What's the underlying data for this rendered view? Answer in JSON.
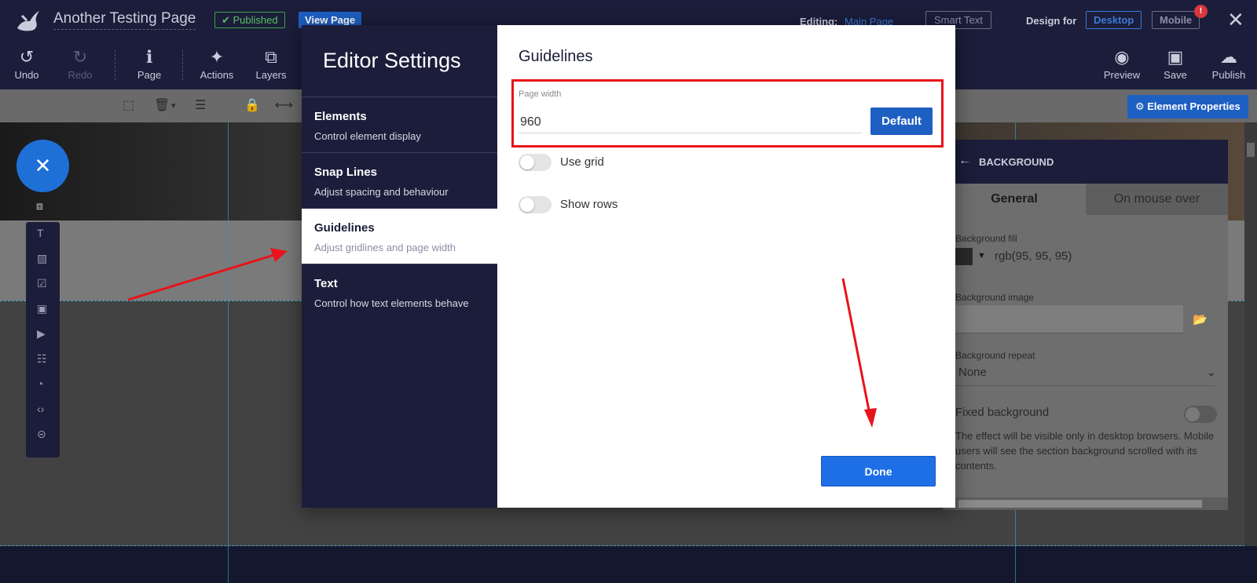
{
  "header": {
    "page_title": "Another Testing Page",
    "published_badge": "✔ Published",
    "view_page": "View Page",
    "editing_label": "Editing:",
    "editing_value": "Main Page",
    "smart_text": "Smart Text",
    "design_for": "Design for",
    "desktop": "Desktop",
    "mobile": "Mobile",
    "alert_count": "!",
    "close": "✕"
  },
  "toolbar": {
    "undo": "Undo",
    "redo": "Redo",
    "page": "Page",
    "actions": "Actions",
    "layers": "Layers",
    "preview": "Preview",
    "save": "Save",
    "publish": "Publish",
    "element_properties": "⚙ Element Properties"
  },
  "background_panel": {
    "title": "BACKGROUND",
    "tab_general": "General",
    "tab_mouse_over": "On mouse over",
    "fill_label": "Background fill",
    "fill_value": "rgb(95, 95, 95)",
    "image_label": "Background image",
    "repeat_label": "Background repeat",
    "repeat_value": "None",
    "fixed_label": "Fixed background",
    "fixed_note": "The effect will be visible only in desktop browsers. Mobile users will see the section background scrolled with its contents."
  },
  "modal": {
    "title": "Editor Settings",
    "nav": [
      {
        "title": "Elements",
        "desc": "Control element display"
      },
      {
        "title": "Snap Lines",
        "desc": "Adjust spacing and behaviour"
      },
      {
        "title": "Guidelines",
        "desc": "Adjust gridlines and page width"
      },
      {
        "title": "Text",
        "desc": "Control how text elements behave"
      }
    ],
    "active_index": 2,
    "content_title": "Guidelines",
    "page_width_label": "Page width",
    "page_width_value": "960",
    "default_button": "Default",
    "use_grid_label": "Use grid",
    "show_rows_label": "Show rows",
    "done_button": "Done"
  },
  "colors": {
    "annotation": "#e8131b",
    "primary_blue": "#1e5fc2",
    "dark_nav": "#1b1d3a"
  }
}
